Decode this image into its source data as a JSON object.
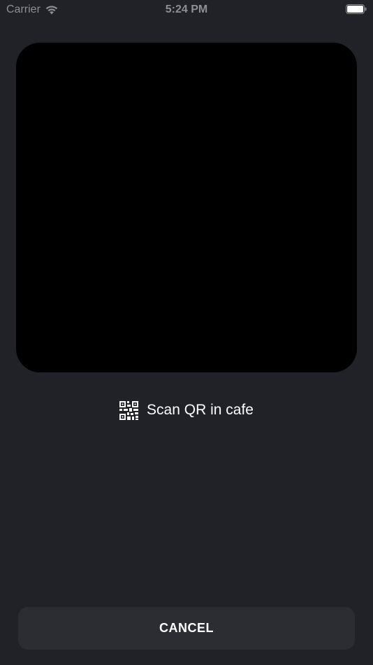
{
  "status_bar": {
    "carrier": "Carrier",
    "time": "5:24 PM",
    "icons": [
      "wifi-icon",
      "battery-icon"
    ]
  },
  "scanner": {
    "hint_icon": "qr-code-icon",
    "hint_text": "Scan QR in cafe"
  },
  "actions": {
    "cancel_label": "CANCEL"
  },
  "colors": {
    "background": "#202227",
    "viewfinder": "#000000",
    "button": "#2b2d33",
    "text": "#ffffff",
    "status_text": "#8e8f93"
  }
}
